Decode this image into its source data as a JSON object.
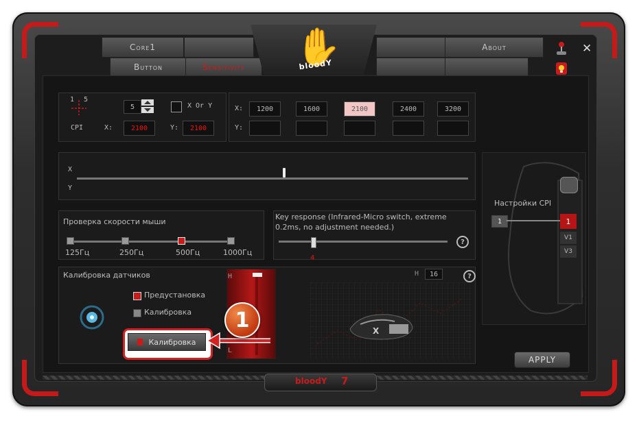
{
  "tabs": {
    "core1": "Core1",
    "button": "Button",
    "sensitivity": "Sensitivity",
    "about": "About"
  },
  "logo_text": "bloodY",
  "footer_logo": "bloodY",
  "footer_num": "7",
  "cpi_panel": {
    "axis_top": "1",
    "axis_right": "5",
    "level_value": "5",
    "xory_label": "X Or Y",
    "cpi_label": "CPI",
    "x_label": "X:",
    "x_value": "2100",
    "y_label": "Y:",
    "y_value": "2100"
  },
  "levels": {
    "x_label": "X:",
    "y_label": "Y:",
    "x_values": [
      "1200",
      "1600",
      "2100",
      "2400",
      "3200"
    ],
    "selected_index": 2
  },
  "slider_panel": {
    "x_label": "X",
    "y_label": "Y",
    "position_fraction": 0.53
  },
  "speed_check": {
    "title": "Проверка скорости мыши",
    "options": [
      "125Гц",
      "250Гц",
      "500Гц",
      "1000Гц"
    ],
    "selected_index": 2
  },
  "key_response": {
    "title": "Key response (Infrared-Micro switch, extreme 0.2ms, no adjustment needed.)",
    "value": "4",
    "help": "?"
  },
  "calibration": {
    "title": "Калибровка датчиков",
    "preset_label": "Предустановка",
    "calib_label": "Калибровка",
    "button_label": "Калибровка",
    "h_label": "H",
    "l_label": "L",
    "badge": "1"
  },
  "right_area": {
    "h_label": "H",
    "h_value": "16",
    "help": "?"
  },
  "cpi_settings": {
    "title": "Настройки CPI",
    "value": "1",
    "mouse_labels": [
      "1",
      "V1",
      "V3"
    ]
  },
  "apply_label": "APPLY",
  "window": {
    "close": "✕"
  },
  "colors": {
    "accent": "#d31919",
    "background": "#1d1d1d"
  }
}
